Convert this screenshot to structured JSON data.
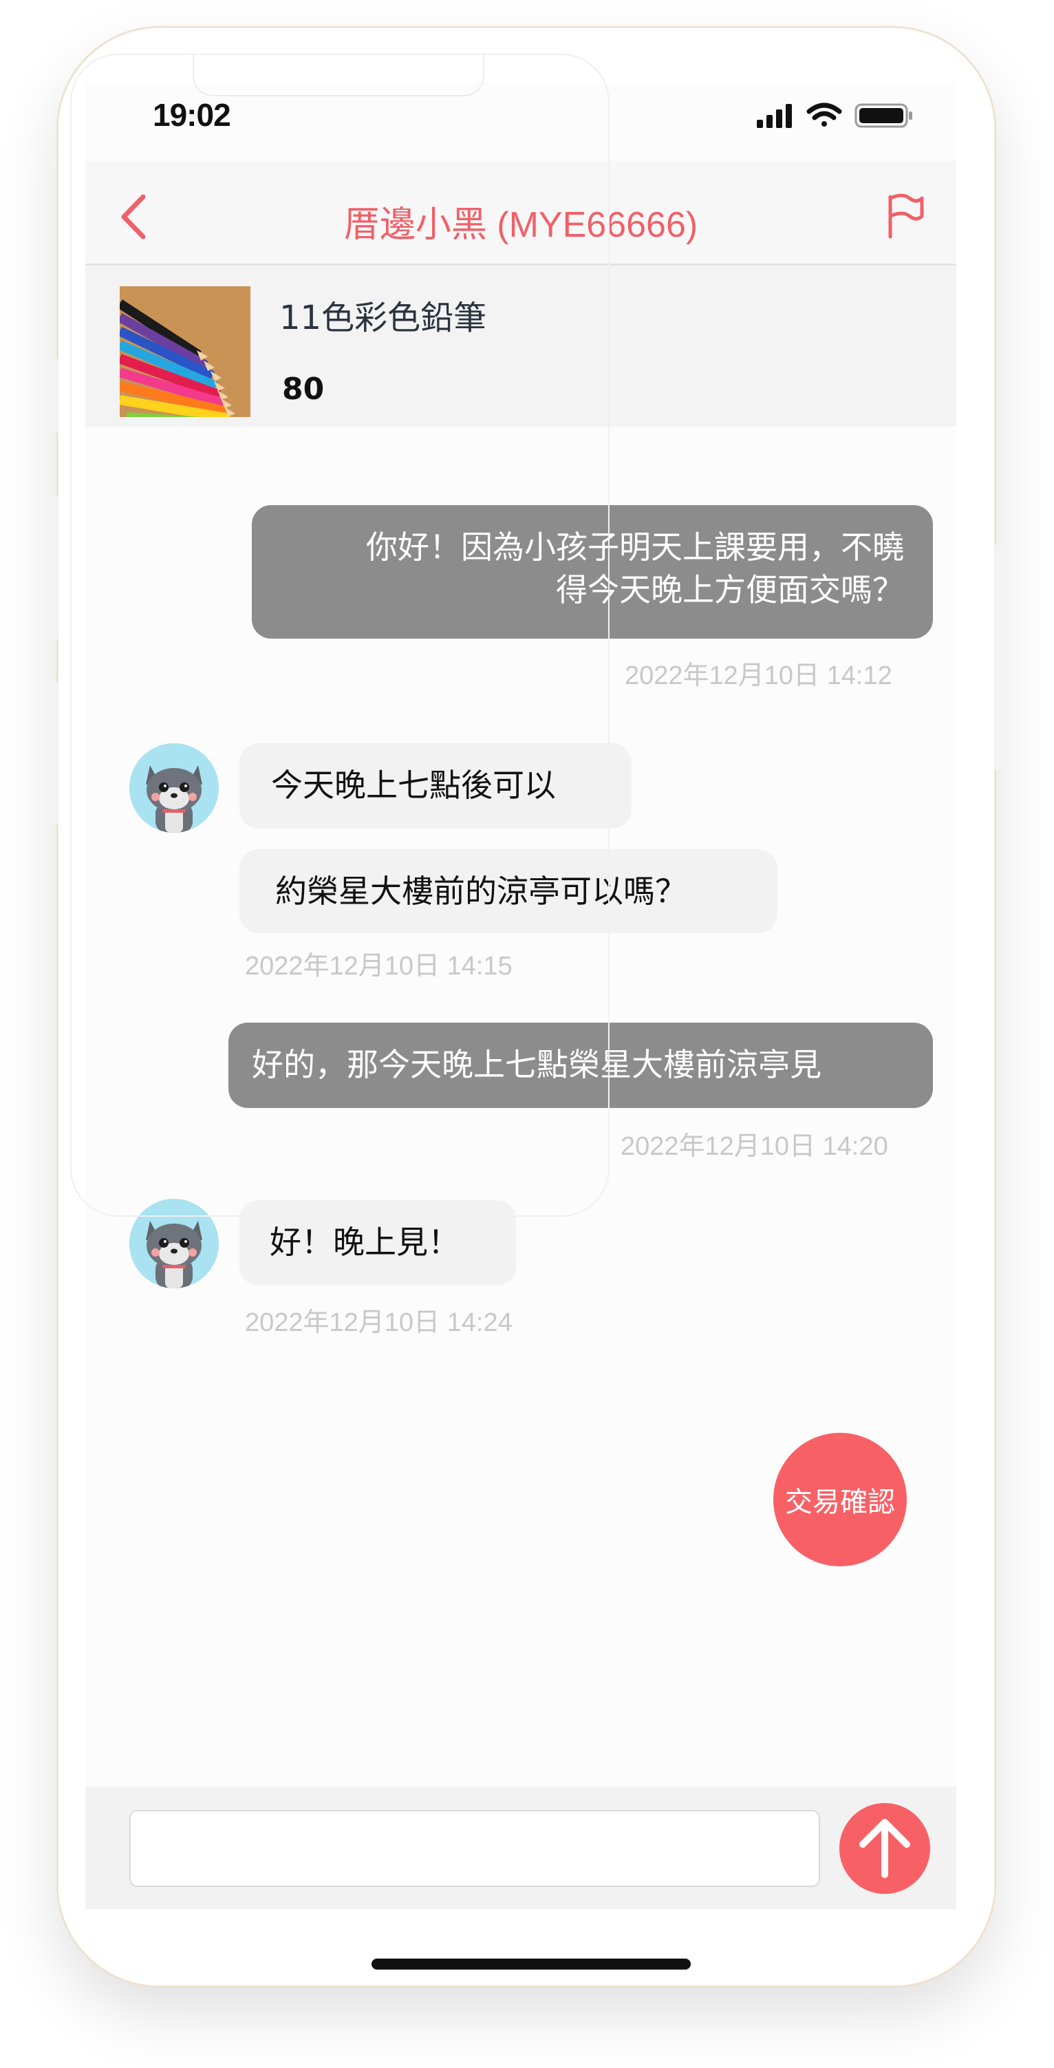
{
  "status_bar": {
    "time": "19:02"
  },
  "header": {
    "title": "厝邊小黑 (MYE66666)"
  },
  "product": {
    "name": "11色彩色鉛筆",
    "price": "80"
  },
  "messages": {
    "m1": {
      "line1": "你好！因為小孩子明天上課要用，不曉",
      "line2": "得今天晚上方便面交嗎？",
      "timestamp": "2022年12月10日 14:12"
    },
    "m2": {
      "text": "今天晚上七點後可以"
    },
    "m3": {
      "text": "約榮星大樓前的涼亭可以嗎？",
      "timestamp": "2022年12月10日 14:15"
    },
    "m4": {
      "text": "好的，那今天晚上七點榮星大樓前涼亭見",
      "timestamp": "2022年12月10日 14:20"
    },
    "m5": {
      "text": "好！晚上見！",
      "timestamp": "2022年12月10日 14:24"
    }
  },
  "actions": {
    "confirm_label": "交易確認"
  },
  "input": {
    "placeholder": "",
    "value": ""
  },
  "colors": {
    "accent": "#f76166",
    "title": "#f06068",
    "outgoing_bubble": "#8c8c8c",
    "incoming_bubble": "#f2f2f2"
  },
  "icons": {
    "back": "chevron-left-icon",
    "report": "flag-icon",
    "send": "arrow-up-icon"
  }
}
